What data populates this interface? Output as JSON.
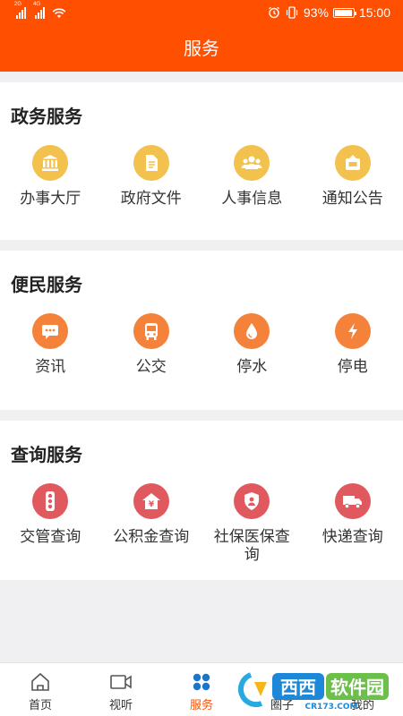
{
  "status_bar": {
    "network_2g": "2G",
    "network_4g": "4G",
    "battery_percent": "93%",
    "battery_level": 0.93,
    "time": "15:00"
  },
  "header": {
    "title": "服务"
  },
  "sections": [
    {
      "title": "政务服务",
      "items": [
        {
          "label": "办事大厅",
          "icon": "bank-building-icon",
          "color": "#f2c14e"
        },
        {
          "label": "政府文件",
          "icon": "document-icon",
          "color": "#f2c14e"
        },
        {
          "label": "人事信息",
          "icon": "people-group-icon",
          "color": "#f2c14e"
        },
        {
          "label": "通知公告",
          "icon": "notice-board-icon",
          "color": "#f2c14e"
        }
      ]
    },
    {
      "title": "便民服务",
      "items": [
        {
          "label": "资讯",
          "icon": "chat-bubble-icon",
          "color": "#f5823a"
        },
        {
          "label": "公交",
          "icon": "bus-icon",
          "color": "#f5823a"
        },
        {
          "label": "停水",
          "icon": "water-drop-icon",
          "color": "#f5823a"
        },
        {
          "label": "停电",
          "icon": "lightning-bolt-icon",
          "color": "#f5823a"
        }
      ]
    },
    {
      "title": "查询服务",
      "items": [
        {
          "label": "交管查询",
          "icon": "traffic-light-icon",
          "color": "#e0595e"
        },
        {
          "label": "公积金查询",
          "icon": "house-yuan-icon",
          "color": "#e0595e"
        },
        {
          "label": "社保医保查询",
          "icon": "shield-person-icon",
          "color": "#e0595e"
        },
        {
          "label": "快递查询",
          "icon": "delivery-truck-icon",
          "color": "#e0595e"
        }
      ]
    }
  ],
  "bottom_nav": {
    "items": [
      {
        "label": "首页",
        "icon": "home-icon",
        "active": false
      },
      {
        "label": "视听",
        "icon": "video-camera-icon",
        "active": false
      },
      {
        "label": "服务",
        "icon": "four-dots-grid-icon",
        "active": true
      },
      {
        "label": "圈子",
        "icon": "circle-icon",
        "active": false
      },
      {
        "label": "我的",
        "icon": "person-icon",
        "active": false
      }
    ]
  },
  "watermark": {
    "brand": "西西软件园",
    "domain": "CR173.COM"
  },
  "colors": {
    "accent": "#ff4f00",
    "gov_icon": "#f2c14e",
    "life_icon": "#f5823a",
    "query_icon": "#e0595e",
    "nav_active": "#1a76c8"
  }
}
